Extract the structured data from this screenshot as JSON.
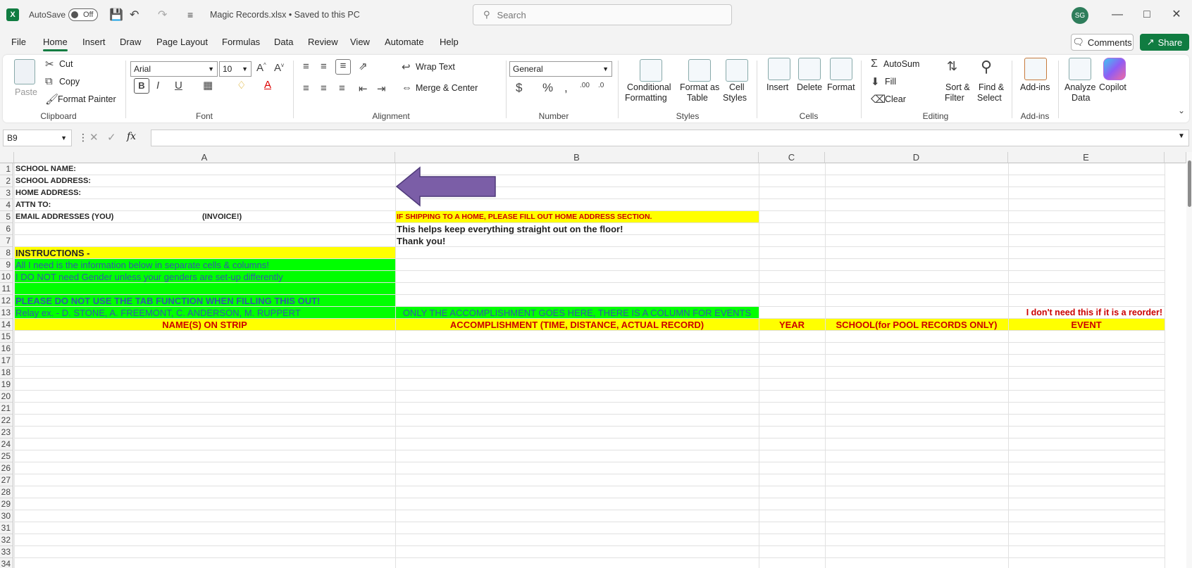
{
  "titlebar": {
    "autosave_label": "AutoSave",
    "autosave_state": "Off",
    "filename": "Magic Records.xlsx • Saved to this PC",
    "search_placeholder": "Search",
    "user_initials": "SG"
  },
  "menubar": {
    "tabs": [
      "File",
      "Home",
      "Insert",
      "Draw",
      "Page Layout",
      "Formulas",
      "Data",
      "Review",
      "View",
      "Automate",
      "Help"
    ],
    "comments_label": "Comments",
    "share_label": "Share"
  },
  "ribbon": {
    "clipboard": {
      "paste": "Paste",
      "cut": "Cut",
      "copy": "Copy",
      "format_painter": "Format Painter",
      "label": "Clipboard"
    },
    "font": {
      "name": "Arial",
      "size": "10",
      "label": "Font"
    },
    "alignment": {
      "wrap_text": "Wrap Text",
      "merge_center": "Merge & Center",
      "label": "Alignment"
    },
    "number": {
      "format": "General",
      "label": "Number"
    },
    "styles": {
      "conditional": "Conditional",
      "formatting": "Formatting",
      "format_as": "Format as",
      "table": "Table",
      "cell": "Cell",
      "styles_word": "Styles",
      "label": "Styles"
    },
    "cells": {
      "insert": "Insert",
      "delete": "Delete",
      "format": "Format",
      "label": "Cells"
    },
    "editing": {
      "autosum": "AutoSum",
      "fill": "Fill",
      "clear": "Clear",
      "sort": "Sort &",
      "filter": "Filter",
      "find": "Find &",
      "select": "Select",
      "label": "Editing"
    },
    "addins": {
      "addins": "Add-ins",
      "label": "Add-ins"
    },
    "analyze": {
      "analyze": "Analyze",
      "data": "Data",
      "copilot": "Copilot"
    }
  },
  "formula_bar": {
    "name_box": "B9",
    "fx": "fx",
    "content": ""
  },
  "columns": [
    "A",
    "B",
    "C",
    "D",
    "E"
  ],
  "rows": [
    "1",
    "2",
    "3",
    "4",
    "5",
    "6",
    "7",
    "8",
    "9",
    "10",
    "11",
    "12",
    "13",
    "14",
    "15",
    "16",
    "17",
    "18",
    "19",
    "20",
    "21",
    "22",
    "23",
    "24",
    "25",
    "26",
    "27",
    "28",
    "29",
    "30",
    "31",
    "32",
    "33",
    "34"
  ],
  "cells": {
    "a1": "SCHOOL NAME:",
    "a2": "SCHOOL ADDRESS:",
    "a3": "HOME ADDRESS:",
    "a4": "ATTN TO:",
    "a5": "EMAIL ADDRESSES (YOU)",
    "a5b": "(INVOICE!)",
    "b5": "IF SHIPPING TO A HOME, PLEASE FILL OUT HOME ADDRESS SECTION.",
    "b6": "This helps keep everything straight out on the floor!",
    "b7": "Thank you!",
    "a8": "INSTRUCTIONS -",
    "a9": "All I need is the information below in separate cells & columns!",
    "a10": "I DO NOT need Gender unless your genders are set-up differently",
    "a12": "PLEASE DO NOT USE THE TAB FUNCTION WHEN FILLING THIS OUT!",
    "a13": "Relay ex. - D. STONE, A. FREEMONT, C. ANDERSON, M. RUPPERT",
    "b13": "ONLY THE ACCOMPLISHMENT GOES HERE, THERE IS A COLUMN FOR EVENTS",
    "e13": "I don't need this if it is a reorder!",
    "a14": "NAME(S) ON STRIP",
    "b14": "ACCOMPLISHMENT (TIME, DISTANCE, ACTUAL RECORD)",
    "c14": "YEAR",
    "d14": "SCHOOL(for POOL RECORDS ONLY)",
    "e14": "EVENT"
  },
  "colors": {
    "yellow": "#ffff00",
    "green": "#00ff00",
    "arrow": "#7b5ea7",
    "excel_green": "#107c41"
  }
}
